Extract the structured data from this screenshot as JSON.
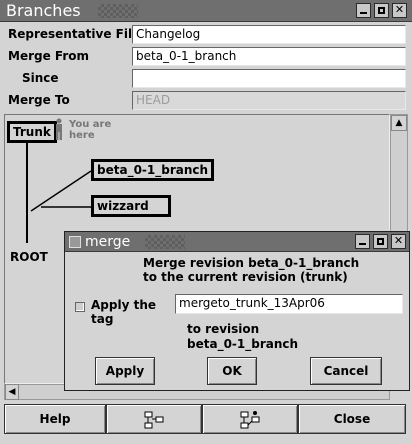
{
  "window": {
    "title": "Branches"
  },
  "form": {
    "representative_file": {
      "label": "Representative File",
      "value": "Changelog"
    },
    "merge_from": {
      "label": "Merge From",
      "value": "beta_0-1_branch"
    },
    "since": {
      "label": "Since",
      "value": ""
    },
    "merge_to": {
      "label": "Merge To",
      "value": "HEAD"
    }
  },
  "graph": {
    "nodes": {
      "trunk": "Trunk",
      "beta": "beta_0-1_branch",
      "wizzard": "wizzard",
      "root": "ROOT"
    },
    "you_are_here": [
      "You are",
      "here"
    ]
  },
  "bottom_buttons": {
    "help": "Help",
    "close": "Close"
  },
  "icons": {
    "branch_tree_1": "branch-tree-icon",
    "branch_tree_2": "branch-merge-icon",
    "person": "person-icon"
  },
  "merge_dialog": {
    "title": "merge",
    "message_line1": "Merge revision beta_0-1_branch",
    "message_line2": "to the current revision (trunk)",
    "apply_tag_label": "Apply the tag",
    "tag_value": "mergeto_trunk_13Apr06",
    "to_revision_line1": "to revision",
    "to_revision_line2": "beta_0-1_branch",
    "apply": "Apply",
    "ok": "OK",
    "cancel": "Cancel"
  },
  "colors": {
    "titlebar": "#6f6f6f",
    "background": "#d4d4d4",
    "input_bg": "#ffffff",
    "disabled_text": "#9c9c9c"
  }
}
